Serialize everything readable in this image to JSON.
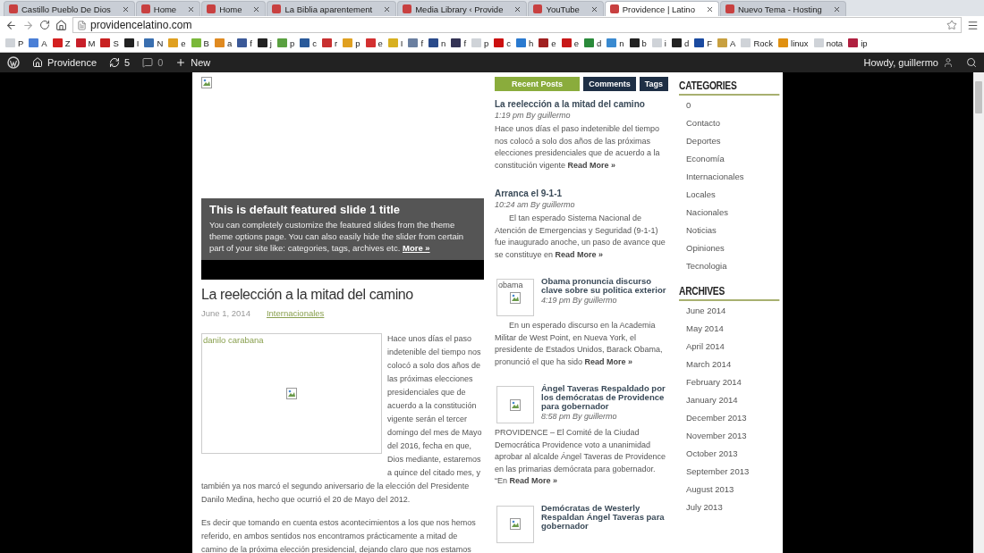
{
  "browser": {
    "tabs": [
      {
        "title": "Castillo Pueblo De Dios",
        "selected": false
      },
      {
        "title": "Home",
        "selected": false
      },
      {
        "title": "Home",
        "selected": false
      },
      {
        "title": "La Biblia aparentement",
        "selected": false
      },
      {
        "title": "Media Library ‹ Provide",
        "selected": false
      },
      {
        "title": "YouTube",
        "selected": false
      },
      {
        "title": "Providence | Latino",
        "selected": true
      },
      {
        "title": "Nuevo Tema - Hosting",
        "selected": false
      }
    ],
    "address": "providencelatino.com",
    "bookmarks": [
      {
        "label": "P",
        "color": "#cfd3d8"
      },
      {
        "label": "A",
        "color": "#4a7fd6"
      },
      {
        "label": "Z",
        "color": "#d32020"
      },
      {
        "label": "M",
        "color": "#c8202a"
      },
      {
        "label": "S",
        "color": "#c82020"
      },
      {
        "label": "I",
        "color": "#222222"
      },
      {
        "label": "N",
        "color": "#3a6fb0"
      },
      {
        "label": "e",
        "color": "#e0a020"
      },
      {
        "label": "B",
        "color": "#7ab83a"
      },
      {
        "label": "a",
        "color": "#e08a20"
      },
      {
        "label": "f",
        "color": "#3b5998"
      },
      {
        "label": "j",
        "color": "#222222"
      },
      {
        "label": "p",
        "color": "#5aa040"
      },
      {
        "label": "c",
        "color": "#2a5a9a"
      },
      {
        "label": "r",
        "color": "#c83030"
      },
      {
        "label": "p",
        "color": "#e0a020"
      },
      {
        "label": "e",
        "color": "#d33030"
      },
      {
        "label": "I",
        "color": "#d8b020"
      },
      {
        "label": "f",
        "color": "#6a7fa0"
      },
      {
        "label": "n",
        "color": "#2a4a8a"
      },
      {
        "label": "f",
        "color": "#333355"
      },
      {
        "label": "p",
        "color": "#cfd3d8"
      },
      {
        "label": "c",
        "color": "#cc1010"
      },
      {
        "label": "h",
        "color": "#2a7ad0"
      },
      {
        "label": "e",
        "color": "#a02020"
      },
      {
        "label": "e",
        "color": "#c81818"
      },
      {
        "label": "d",
        "color": "#2a8a3a"
      },
      {
        "label": "n",
        "color": "#3a8ad0"
      },
      {
        "label": "b",
        "color": "#222222"
      },
      {
        "label": "i",
        "color": "#cfd3d8"
      },
      {
        "label": "d",
        "color": "#222222"
      },
      {
        "label": "F",
        "color": "#1a4aa0"
      },
      {
        "label": "A",
        "color": "#c8a040"
      },
      {
        "label": "Rock",
        "color": "#cfd3d8"
      },
      {
        "label": "linux",
        "color": "#e09010"
      },
      {
        "label": "nota",
        "color": "#cfd3d8"
      },
      {
        "label": "ip",
        "color": "#b02040"
      }
    ]
  },
  "admin_bar": {
    "site_name": "Providence",
    "updates": "5",
    "comments": "0",
    "new_label": "New",
    "greeting": "Howdy, guillermo"
  },
  "slider": {
    "title": "This is default featured slide 1 title",
    "text": "You can completely customize the featured slides from the theme theme options page. You can also easily hide the slider from certain part of your site like: categories, tags, archives etc.",
    "more_link": "More »"
  },
  "post": {
    "title": "La reelección a la mitad del camino",
    "date": "June 1, 2014",
    "category": "Internacionales",
    "image_caption": "danilo carabana",
    "text_beside_image": "Hace unos días el paso indetenible del tiempo nos colocó a solo dos años de las próximas elecciones presidenciales que de acuerdo a la constitución vigente serán el tercer domingo del mes de Mayo del 2016, fecha en que, Dios mediante, estaremos a quince del citado mes, y",
    "paragraphs": [
      "también ya nos marcó el segundo aniversario de la elección del Presidente Danilo Medina, hecho que ocurrió el 20 de Mayo del 2012.",
      "Es decir que tomando en cuenta estos acontecimientos a los que nos hemos referido, en ambos sentidos nos encontramos prácticamente a mitad de camino de la próxima elección presidencial, dejando claro que nos estamos"
    ]
  },
  "widget_tabs": [
    {
      "label": "Recent Posts",
      "selected": true
    },
    {
      "label": "Comments",
      "selected": false
    },
    {
      "label": "Tags",
      "selected": false
    }
  ],
  "recent_posts": [
    {
      "kind": "text",
      "title": "La reelección a la mitad del camino",
      "meta": "1:19 pm By guillermo",
      "excerpt": "Hace unos días el paso indetenible del tiempo nos colocó a solo dos años de las próximas elecciones presidenciales que de acuerdo a la constitución vigente",
      "read_more": "Read More »"
    },
    {
      "kind": "text",
      "title": "Arranca el 9-1-1",
      "meta": "10:24 am By guillermo",
      "excerpt": "El tan esperado Sistema Nacional de Atención de Emergencias y Seguridad (9-1-1) fue inaugurado anoche, un paso de avance que se constituye en",
      "read_more": "Read More »"
    },
    {
      "kind": "thumb",
      "thumb_caption": "obama",
      "title": "Obama pronuncia discurso clave sobre su politica exterior",
      "meta": "4:19 pm By guillermo",
      "excerpt": "En un esperado discurso en la Academia Militar de West Point, en Nueva York, el presidente de Estados Unidos, Barack Obama, pronunció el que ha sido",
      "read_more": "Read More »"
    },
    {
      "kind": "thumb",
      "title": "Ángel Taveras Respaldado por los demócratas de Providence para gobernador",
      "meta": "8:58 pm By guillermo",
      "excerpt": "PROVIDENCE – El Comité de la Ciudad Democrática Providence  voto a unanimidad aprobar al alcalde Ángel Taveras de Providence en las primarias demócrata para gobernador. “En",
      "read_more": "Read More »"
    },
    {
      "kind": "thumb",
      "title": "Demócratas de Westerly Respaldan Ángel Taveras para gobernador"
    }
  ],
  "sidebar": [
    {
      "heading": "CATEGORIES",
      "items": [
        "0",
        "Contacto",
        "Deportes",
        "Economía",
        "Internacionales",
        "Locales",
        "Nacionales",
        "Noticias",
        "Opiniones",
        "Tecnologia"
      ]
    },
    {
      "heading": "ARCHIVES",
      "items": [
        "June 2014",
        "May 2014",
        "April 2014",
        "March 2014",
        "February 2014",
        "January 2014",
        "December 2013",
        "November 2013",
        "October 2013",
        "September 2013",
        "August 2013",
        "July 2013"
      ]
    }
  ]
}
